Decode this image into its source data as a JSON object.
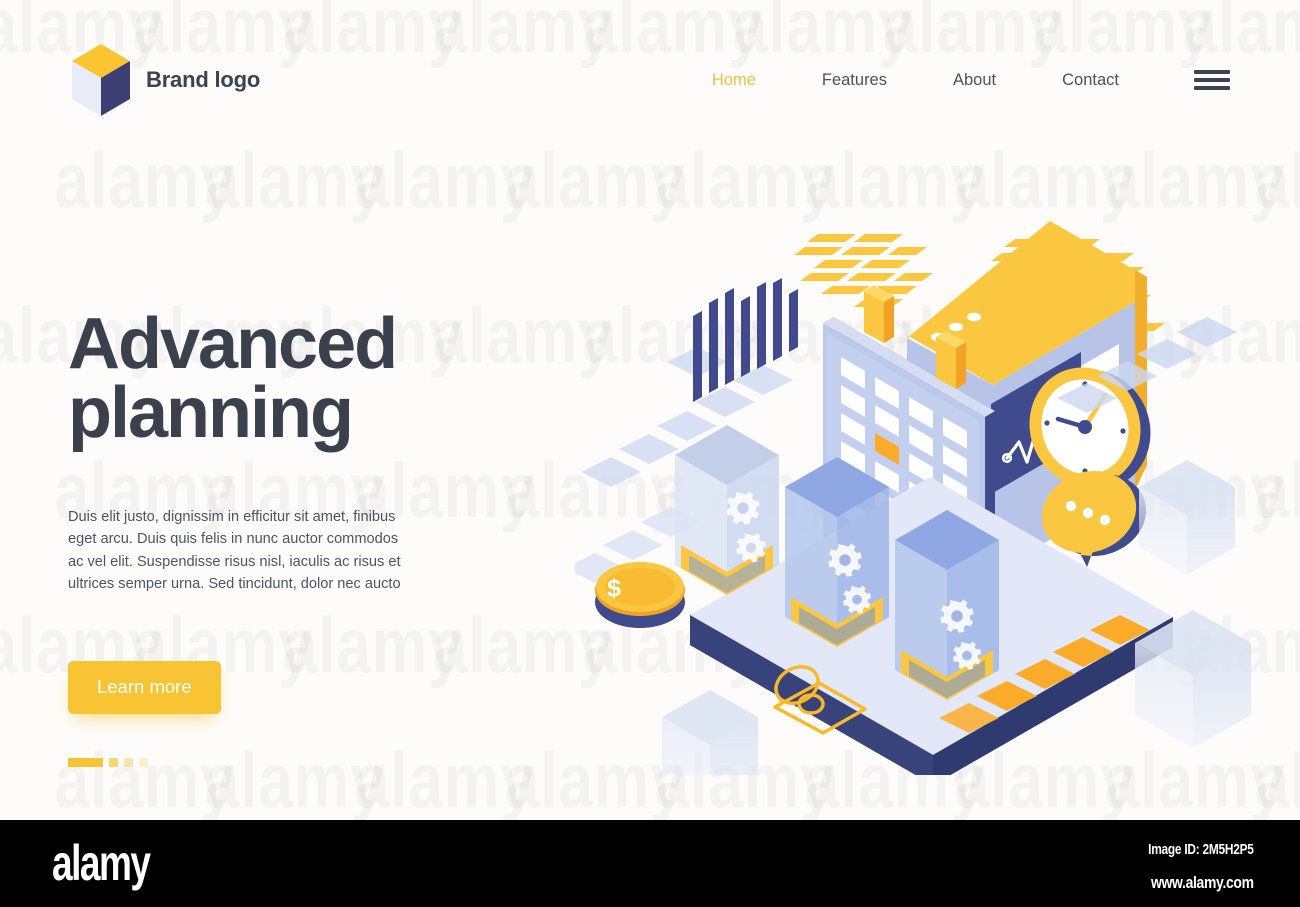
{
  "page": {
    "background_color": "#fdfcfa",
    "accent_yellow": "#f9c434",
    "accent_navy": "#3f4b8c",
    "text_dark": "#3a414d"
  },
  "header": {
    "brand_name": "Brand logo",
    "logo_icon": "isometric-cube-logo",
    "nav": [
      {
        "label": "Home",
        "active": true
      },
      {
        "label": "Features",
        "active": false
      },
      {
        "label": "About",
        "active": false
      },
      {
        "label": "Contact",
        "active": false
      }
    ],
    "menu_icon": "hamburger-menu-icon"
  },
  "hero": {
    "headline": "Advanced\nplanning",
    "paragraph": "Duis elit justo, dignissim in efficitur sit amet, finibus eget arcu. Duis quis felis in nunc auctor commodos ac vel elit. Suspendisse risus nisl, iaculis ac risus et ultrices semper urna. Sed tincidunt, dolor nec aucto",
    "cta_label": "Learn more",
    "pagination": {
      "active_index": 0,
      "total": 4
    }
  },
  "illustration": {
    "name": "isometric-planning-scene",
    "elements": [
      "calendar-board",
      "browser-window",
      "line-chart-panel",
      "analog-clock",
      "chat-bubble",
      "bar-chart",
      "dollar-coin",
      "user-avatar-outline",
      "gear-icons",
      "tower-bars",
      "isometric-platform",
      "floating-cubes",
      "diamond-tiles",
      "brick-dashes"
    ]
  },
  "watermark": {
    "text": "alamy"
  },
  "footer": {
    "logo_text": "alamy",
    "image_id": "Image ID: 2M5H2P5",
    "website": "www.alamy.com"
  }
}
